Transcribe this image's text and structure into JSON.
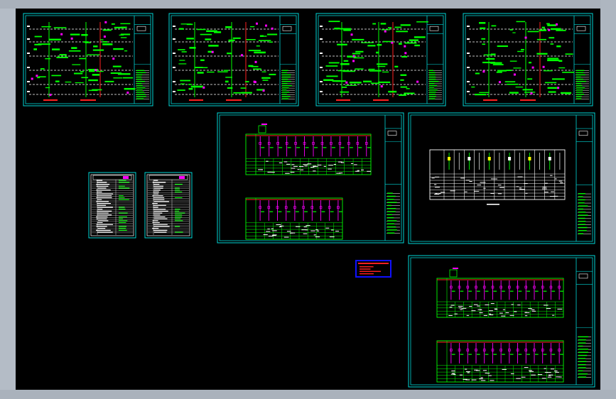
{
  "viewer": {
    "background": "#000000",
    "frame_color": "#00d6d6",
    "line_color": "#00ff00",
    "accent_color": "#ff00ff",
    "alert_color": "#ff2020",
    "legend_border": "#1010ff"
  },
  "sheets": [
    {
      "id": "riser-1",
      "kind": "riser"
    },
    {
      "id": "riser-2",
      "kind": "riser"
    },
    {
      "id": "riser-3",
      "kind": "riser"
    },
    {
      "id": "riser-4",
      "kind": "riser"
    },
    {
      "id": "index-1",
      "kind": "index"
    },
    {
      "id": "index-2",
      "kind": "index"
    },
    {
      "id": "panel-schedule-1",
      "kind": "panel"
    },
    {
      "id": "panel-schedule-2",
      "kind": "panel-white"
    },
    {
      "id": "panel-schedule-3",
      "kind": "panel"
    }
  ],
  "legend_box": {
    "id": "legend-note",
    "kind": "legend"
  }
}
